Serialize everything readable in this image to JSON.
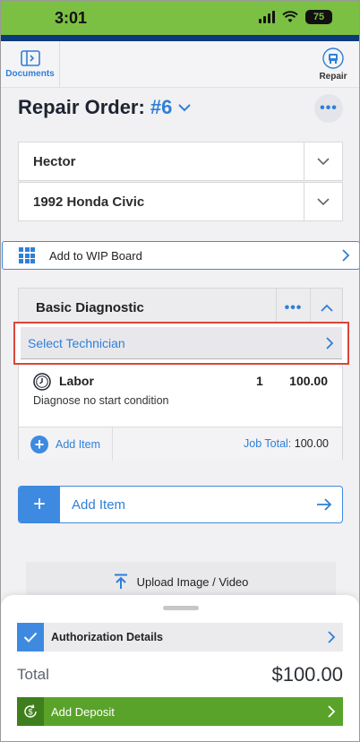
{
  "status_bar": {
    "time": "3:01",
    "battery": "75"
  },
  "toolbar": {
    "documents_label": "Documents",
    "repair_label": "Repair"
  },
  "header": {
    "title": "Repair Order:",
    "order_number": "#6"
  },
  "customer": {
    "name": "Hector"
  },
  "vehicle": {
    "name": "1992 Honda Civic"
  },
  "wip": {
    "label": "Add to WIP Board"
  },
  "job": {
    "name": "Basic Diagnostic",
    "technician_placeholder": "Select Technician",
    "line": {
      "type": "Labor",
      "qty": "1",
      "amount": "100.00",
      "description": "Diagnose no start condition"
    },
    "add_item_label": "Add Item",
    "total_label": "Job Total:",
    "total_value": "100.00"
  },
  "add_item": {
    "label": "Add Item"
  },
  "upload": {
    "label": "Upload Image / Video"
  },
  "summary": {
    "authorization_label": "Authorization Details",
    "total_label": "Total",
    "total_value": "$100.00",
    "deposit_label": "Add Deposit"
  },
  "colors": {
    "accent": "#2f7fd8",
    "status_green": "#7bc043",
    "deposit_green": "#5aa32a",
    "highlight": "#d9463a",
    "nav_blue": "#0d3a7a"
  }
}
